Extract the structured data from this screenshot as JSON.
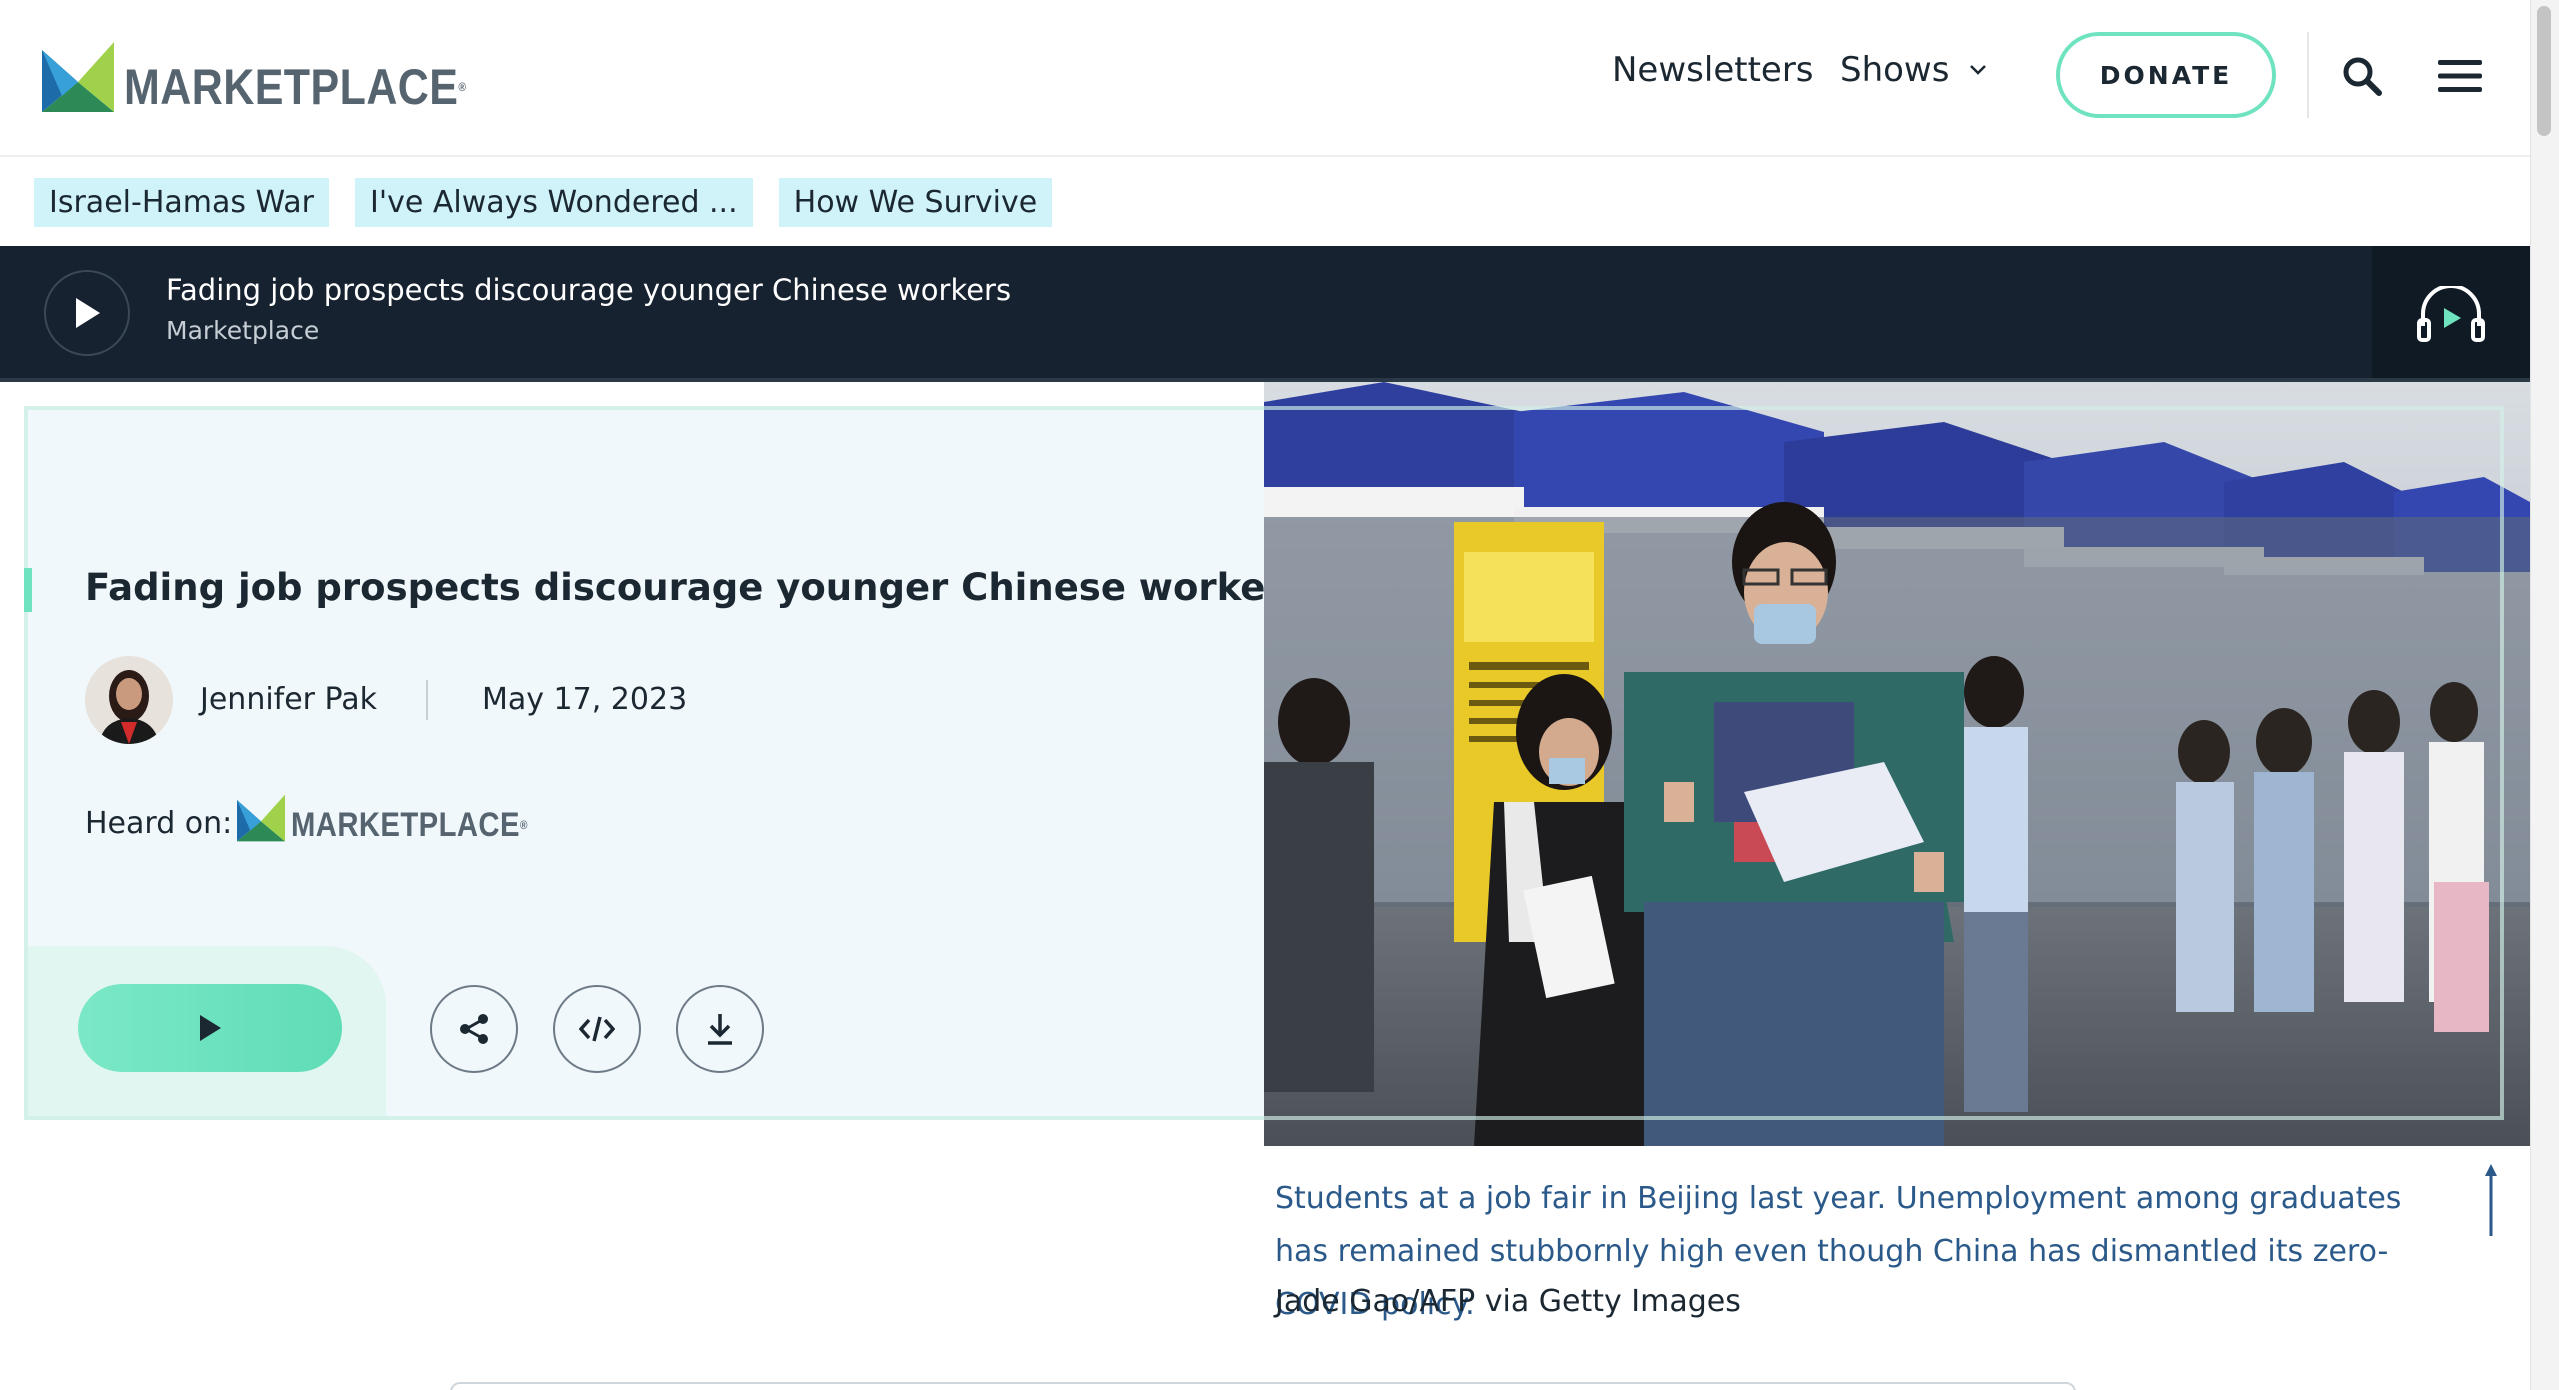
{
  "header": {
    "logo_text": "MARKETPLACE",
    "nav": {
      "newsletters": "Newsletters",
      "shows": "Shows"
    },
    "donate_label": "DONATE"
  },
  "topic_tags": [
    "Israel-Hamas War",
    "I've Always Wondered ...",
    "How We Survive"
  ],
  "player": {
    "title": "Fading job prospects discourage younger Chinese workers",
    "subtitle": "Marketplace"
  },
  "story": {
    "headline": "Fading job prospects discourage younger Chinese workers",
    "author": "Jennifer Pak",
    "date": "May 17, 2023",
    "heard_on_label": "Heard on:",
    "heard_on_logo": "MARKETPLACE"
  },
  "image": {
    "caption": "Students at a job fair in Beijing last year. Unemployment among graduates has remained stubbornly high even though China has dismantled its zero-COVID policy.",
    "credit": "Jade Gao/AFP via Getty Images"
  },
  "colors": {
    "accent_green": "#6fe3bf",
    "tag_background": "#cff3f8",
    "player_background": "#162230",
    "caption_blue": "#2b5a8a"
  },
  "icons": {
    "search": "search-icon",
    "menu": "hamburger-menu-icon",
    "play": "play-icon",
    "headphones": "headphones-play-icon",
    "share": "share-icon",
    "embed": "embed-code-icon",
    "download": "download-icon"
  }
}
